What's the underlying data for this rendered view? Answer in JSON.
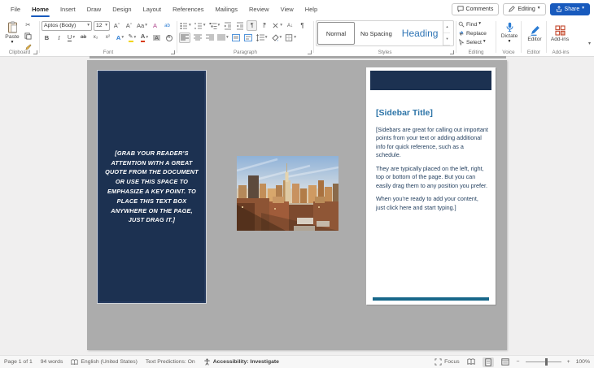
{
  "menubar": {
    "tabs": [
      {
        "label": "File"
      },
      {
        "label": "Home"
      },
      {
        "label": "Insert"
      },
      {
        "label": "Draw"
      },
      {
        "label": "Design"
      },
      {
        "label": "Layout"
      },
      {
        "label": "References"
      },
      {
        "label": "Mailings"
      },
      {
        "label": "Review"
      },
      {
        "label": "View"
      },
      {
        "label": "Help"
      }
    ],
    "active_tab": "Home",
    "comments_label": "Comments",
    "editing_label": "Editing",
    "share_label": "Share"
  },
  "ribbon": {
    "clipboard": {
      "label": "Clipboard",
      "paste_label": "Paste"
    },
    "font": {
      "label": "Font",
      "font_name": "Aptos (Body)",
      "font_size": "12"
    },
    "paragraph": {
      "label": "Paragraph"
    },
    "styles": {
      "label": "Styles",
      "items": [
        {
          "name": "Normal"
        },
        {
          "name": "No Spacing"
        },
        {
          "name": "Heading"
        }
      ],
      "selected": "Normal"
    },
    "editing": {
      "label": "Editing",
      "find_label": "Find",
      "replace_label": "Replace",
      "select_label": "Select"
    },
    "voice": {
      "label": "Voice",
      "dictate_label": "Dictate"
    },
    "editor_group": {
      "label": "Editor",
      "editor_label": "Editor"
    },
    "addins": {
      "label": "Add-ins",
      "addins_label": "Add-ins"
    }
  },
  "icons": {
    "bold": "B",
    "italic": "I",
    "underline": "U",
    "strikethrough": "ab",
    "subscript": "x₂",
    "superscript": "x²",
    "grow_font": "Aˆ",
    "shrink_font": "Aˇ",
    "change_case": "Aa",
    "clear_format": "A",
    "phonetic": "ab",
    "char_border": "A",
    "text_effects": "A",
    "highlight_pen": "✎",
    "font_color": "A",
    "char_shading": "A",
    "enclose": "A",
    "pilcrow": "¶",
    "caret": "▾",
    "up_arrow": "▴",
    "scissors": "✂",
    "sort": "A↓",
    "minus": "−",
    "plus": "+"
  },
  "document": {
    "quote_box": {
      "text": "[GRAB YOUR READER’S ATTENTION WITH A GREAT QUOTE FROM THE DOCUMENT OR USE THIS SPACE TO EMPHASIZE A KEY POINT. TO PLACE THIS TEXT BOX ANYWHERE ON THE PAGE, JUST DRAG IT.]"
    },
    "photo": {
      "description": "New York City skyline at sunset"
    },
    "sidebar": {
      "title": "[Sidebar Title]",
      "paragraphs": [
        "[Sidebars are great for calling out important points from your text or adding additional info for quick reference, such as a schedule.",
        "They are typically placed on the left, right, top or bottom of the page. But you can easily drag them to any position you prefer.",
        "When you’re ready to add your content, just click here and start typing.]"
      ]
    }
  },
  "statusbar": {
    "page": "Page 1 of 1",
    "words": "94 words",
    "language": "English (United States)",
    "text_predictions": "Text Predictions: On",
    "accessibility": "Accessibility: Investigate",
    "focus": "Focus",
    "zoom_value": "100%"
  }
}
